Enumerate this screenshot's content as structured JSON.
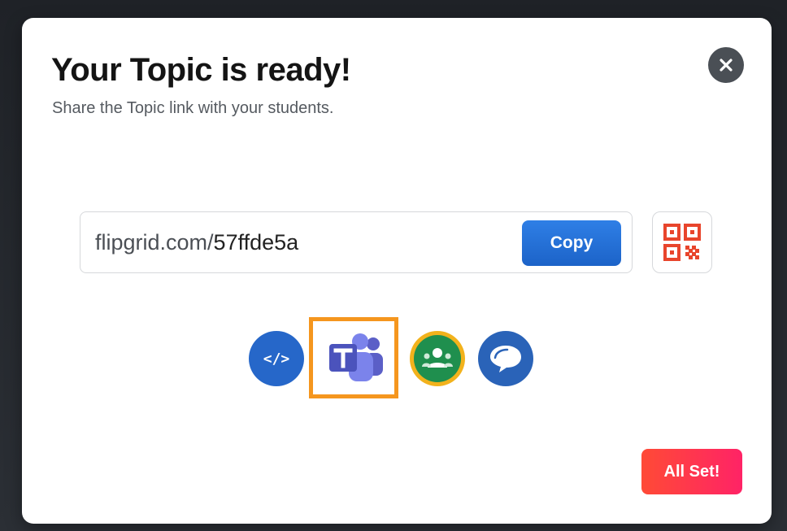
{
  "modal": {
    "title": "Your Topic is ready!",
    "subtitle": "Share the Topic link with your students.",
    "close_icon": "close-icon"
  },
  "link": {
    "domain": "flipgrid.com/",
    "code": "57ffde5a",
    "copy_label": "Copy",
    "qr_icon": "qr-code-icon"
  },
  "share": {
    "embed_label": "</>",
    "icons": [
      "embed-code-icon",
      "microsoft-teams-icon",
      "google-classroom-icon",
      "remind-icon"
    ],
    "highlight_color": "#f5961e"
  },
  "actions": {
    "done_label": "All Set!"
  },
  "colors": {
    "primary_blue": "#2f7fe6",
    "all_set_gradient": [
      "#ff4a36",
      "#ff2366"
    ],
    "classroom_green": "#1f8f4e",
    "classroom_ring": "#f2b21c",
    "teams_purple": "#5b5fc7"
  }
}
